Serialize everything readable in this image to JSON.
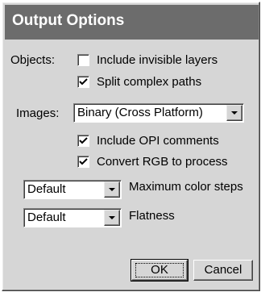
{
  "dialog": {
    "title": "Output Options"
  },
  "objects": {
    "label": "Objects:",
    "include_invisible_layers": {
      "label": "Include invisible layers",
      "checked": false
    },
    "split_complex_paths": {
      "label": "Split complex paths",
      "checked": true
    }
  },
  "images": {
    "label": "Images:",
    "format_selected": "Binary (Cross Platform)",
    "include_opi_comments": {
      "label": "Include OPI comments",
      "checked": true
    },
    "convert_rgb_to_process": {
      "label": "Convert RGB to process",
      "checked": true
    }
  },
  "color_steps": {
    "selected": "Default",
    "label": "Maximum color steps"
  },
  "flatness": {
    "selected": "Default",
    "label": "Flatness"
  },
  "buttons": {
    "ok": "OK",
    "cancel": "Cancel"
  }
}
